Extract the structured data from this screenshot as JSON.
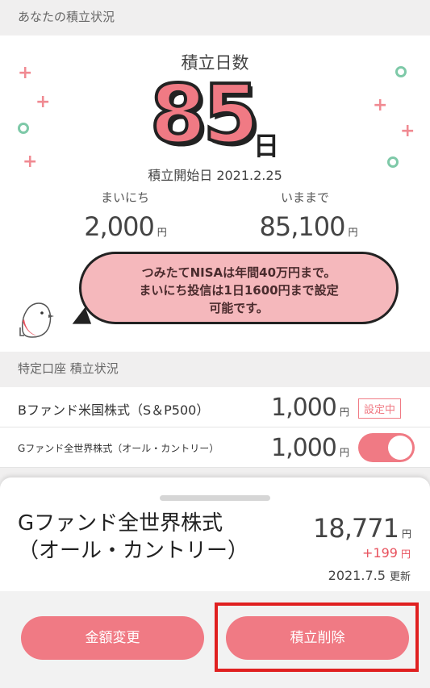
{
  "summary": {
    "header": "あなたの積立状況",
    "days_title": "積立日数",
    "days_count": "85",
    "days_unit": "日",
    "start_date": "積立開始日 2021.2.25",
    "daily_label": "まいにち",
    "daily_amount": "2,000",
    "total_label": "いままで",
    "total_amount": "85,100",
    "yen": "円",
    "bubble_lines": [
      "つみたてNISAは年間40万円まで。",
      "まいにち投信は1日1600円まで設定",
      "可能です。"
    ]
  },
  "accounts": {
    "header": "特定口座 積立状況",
    "rows": [
      {
        "name": "Bファンド米国株式（S＆P500）",
        "amount": "1,000",
        "status": "設定中"
      },
      {
        "name": "Gファンド全世界株式（オール・カントリー）",
        "amount": "1,000",
        "toggle_on": true
      }
    ]
  },
  "detail": {
    "fund_name_line1": "Gファンド全世界株式",
    "fund_name_line2": "（オール・カントリー）",
    "value": "18,771",
    "diff": "+199",
    "updated": "2021.7.5",
    "updated_suffix": "更新"
  },
  "footer": {
    "change_amount_label": "金額変更",
    "delete_label": "積立削除"
  },
  "colors": {
    "accent": "#f07a84",
    "highlight": "#e02020",
    "ring": "#7ec9a8"
  },
  "icons": {
    "mascot": "bird-icon",
    "plus": "plus-icon",
    "ring": "ring-icon"
  }
}
